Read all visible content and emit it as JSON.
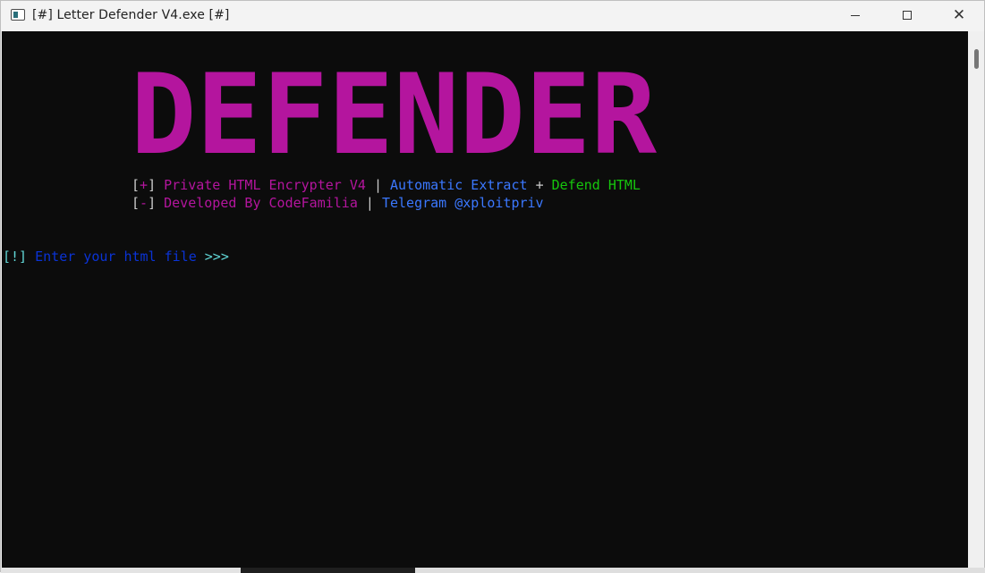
{
  "window": {
    "title": "[#] Letter Defender V4.exe [#]",
    "icon": "console-window-icon",
    "controls": {
      "minimize": "minimize-icon",
      "maximize": "maximize-icon",
      "close": "✕"
    }
  },
  "console": {
    "background": "#0c0c0c",
    "banner_text": "DEFENDER",
    "banner_color": "#b4159e",
    "line1": {
      "open_bracket": "[",
      "sign": "+",
      "close_bracket": "]",
      "text1": "Private HTML Encrypter V4",
      "sep": "|",
      "text2": "Automatic Extract",
      "plus": "+",
      "text3": "Defend HTML"
    },
    "line2": {
      "open_bracket": "[",
      "sign": "-",
      "close_bracket": "]",
      "text1": "Developed By CodeFamilia",
      "sep": "|",
      "text2": "Telegram @xploitpriv"
    },
    "prompt": {
      "tag": "[!]",
      "text": "Enter your html file",
      "arrows": ">>>"
    }
  },
  "colors": {
    "white": "#cccccc",
    "magenta": "#b4159e",
    "blue": "#3b78ff",
    "green": "#16c60c",
    "dark_blue": "#0a33d6",
    "cyan": "#61d6d6"
  }
}
